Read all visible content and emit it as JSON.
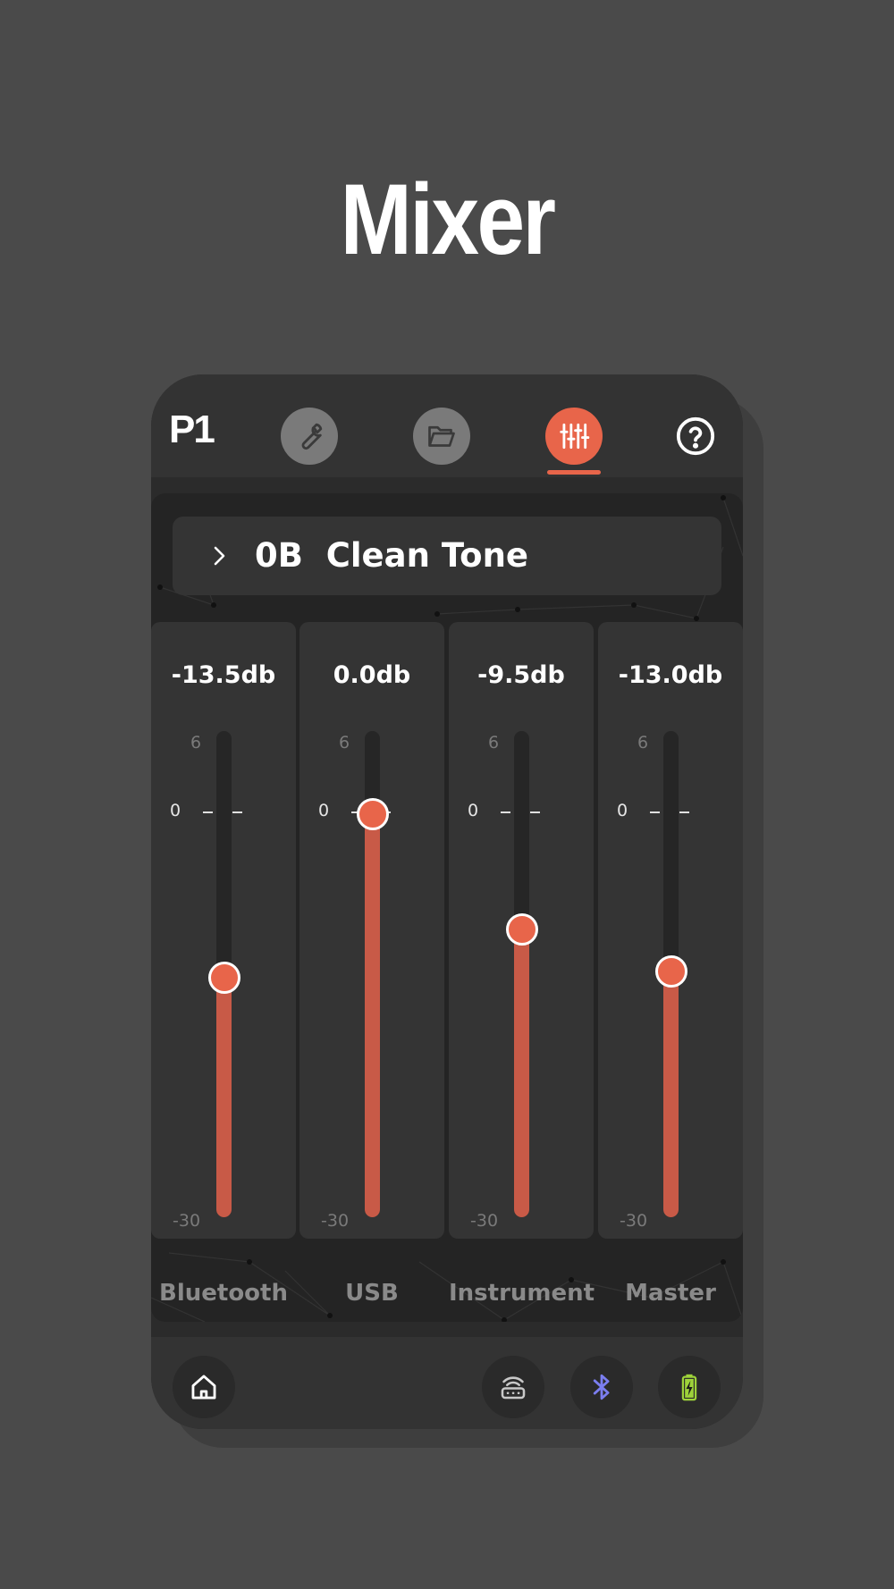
{
  "page_title": "Mixer",
  "app": {
    "logo_text": "P1",
    "nav": [
      {
        "name": "tools",
        "icon": "wrench-icon",
        "active": false
      },
      {
        "name": "presets",
        "icon": "folder-open-icon",
        "active": false
      },
      {
        "name": "mixer",
        "icon": "sliders-icon",
        "active": true
      },
      {
        "name": "help",
        "icon": "help-circle-icon",
        "active": false
      }
    ],
    "preset": {
      "label": "0B  Clean Tone",
      "icon": "chevron-right-icon"
    },
    "scale": {
      "top": "6",
      "zero": "0",
      "bottom": "-30",
      "min_db": -30,
      "max_db": 6
    },
    "channels": [
      {
        "label": "Bluetooth",
        "db_text": "-13.5db",
        "db": -13.5
      },
      {
        "label": "USB",
        "db_text": "0.0db",
        "db": 0.0
      },
      {
        "label": "Instrument",
        "db_text": "-9.5db",
        "db": -9.5
      },
      {
        "label": "Master",
        "db_text": "-13.0db",
        "db": -13.0
      }
    ],
    "bottom_bar": [
      {
        "name": "home",
        "icon": "home-icon"
      },
      {
        "name": "wireless-device",
        "icon": "wireless-device-icon"
      },
      {
        "name": "bluetooth",
        "icon": "bluetooth-icon"
      },
      {
        "name": "battery",
        "icon": "battery-charging-icon"
      }
    ],
    "colors": {
      "accent": "#e8654a",
      "fill": "#c85a47",
      "bluetooth": "#7b7ef0",
      "battery": "#9ed23a"
    }
  }
}
